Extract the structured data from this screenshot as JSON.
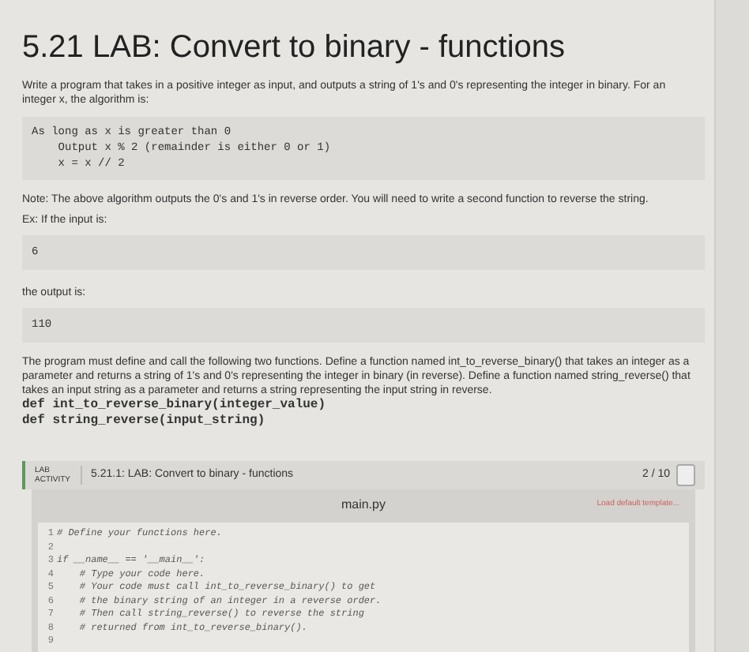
{
  "title": "5.21 LAB: Convert to binary - functions",
  "intro": "Write a program that takes in a positive integer as input, and outputs a string of 1's and 0's representing the integer in binary. For an integer x, the algorithm is:",
  "algorithm": [
    "As long as x is greater than 0",
    "    Output x % 2 (remainder is either 0 or 1)",
    "    x = x // 2"
  ],
  "note": "Note: The above algorithm outputs the 0's and 1's in reverse order. You will need to write a second function to reverse the string.",
  "example_label": "Ex: If the input is:",
  "example_input": "6",
  "output_label": "the output is:",
  "example_output": "110",
  "requirements": "The program must define and call the following two functions. Define a function named int_to_reverse_binary() that takes an integer as a parameter and returns a string of 1's and 0's representing the integer in binary (in reverse). Define a function named string_reverse() that takes an input string as a parameter and returns a string representing the input string in reverse.",
  "signatures": [
    "def int_to_reverse_binary(integer_value)",
    "def string_reverse(input_string)"
  ],
  "lab": {
    "badge": [
      "LAB",
      "ACTIVITY"
    ],
    "title": "5.21.1: LAB: Convert to binary - functions",
    "score": "2 / 10"
  },
  "editor": {
    "filename": "main.py",
    "template_link": "Load default template...",
    "lines": [
      {
        "number": "1",
        "code": "# Define your functions here."
      },
      {
        "number": "2"
      },
      {
        "number": "3",
        "code": "if __name__ == '__main__':"
      },
      {
        "number": "4",
        "code": "    # Type your code here."
      },
      {
        "number": "5",
        "code": "    # Your code must call int_to_reverse_binary() to get"
      },
      {
        "number": "6",
        "code": "    # the binary string of an integer in a reverse order."
      },
      {
        "number": "7",
        "code": "    # Then call string_reverse() to reverse the string"
      },
      {
        "number": "8",
        "code": "    # returned from int_to_reverse_binary()."
      },
      {
        "number": "9"
      }
    ]
  }
}
